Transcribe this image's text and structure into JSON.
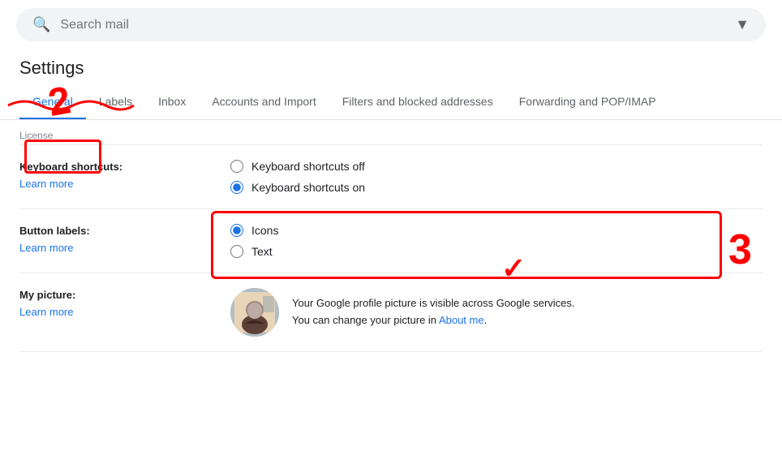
{
  "search": {
    "placeholder": "Search mail",
    "icon": "🔍",
    "dropdown_icon": "▼"
  },
  "page_title": "Settings",
  "tabs": [
    {
      "id": "general",
      "label": "General",
      "active": true
    },
    {
      "id": "labels",
      "label": "Labels",
      "active": false
    },
    {
      "id": "inbox",
      "label": "Inbox",
      "active": false
    },
    {
      "id": "accounts",
      "label": "Accounts and Import",
      "active": false
    },
    {
      "id": "filters",
      "label": "Filters and blocked addresses",
      "active": false
    },
    {
      "id": "forwarding",
      "label": "Forwarding and POP/IMAP",
      "active": false
    }
  ],
  "settings": {
    "section_top_label": "License",
    "keyboard_shortcuts": {
      "label": "Keyboard shortcuts:",
      "learn_more": "Learn more",
      "options": [
        {
          "id": "off",
          "label": "Keyboard shortcuts off",
          "checked": false
        },
        {
          "id": "on",
          "label": "Keyboard shortcuts on",
          "checked": true
        }
      ]
    },
    "button_labels": {
      "label": "Button labels:",
      "learn_more": "Learn more",
      "options": [
        {
          "id": "icons",
          "label": "Icons",
          "checked": true
        },
        {
          "id": "text",
          "label": "Text",
          "checked": false
        }
      ]
    },
    "my_picture": {
      "label": "My picture:",
      "learn_more": "Learn more",
      "description_part1": "Your Google profile picture is visible across Google services.",
      "description_part2": "You can change your picture in ",
      "link_text": "About me",
      "description_end": "."
    }
  },
  "annotations": {
    "num2": "2",
    "num3": "3",
    "checkmark": "✓"
  }
}
